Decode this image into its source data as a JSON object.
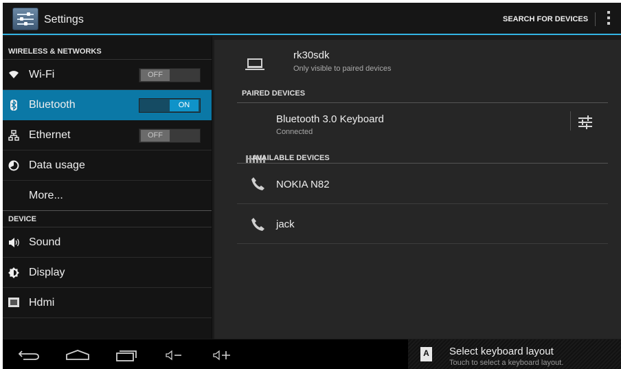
{
  "action_bar": {
    "title": "Settings",
    "search_label": "SEARCH FOR DEVICES",
    "app_icon": "settings-sliders-icon",
    "overflow_icon": "overflow-menu-icon"
  },
  "sidebar": {
    "wireless_header": "WIRELESS & NETWORKS",
    "device_header": "DEVICE",
    "items": [
      {
        "label": "Wi-Fi",
        "icon": "wifi-icon",
        "toggle": "OFF"
      },
      {
        "label": "Bluetooth",
        "icon": "bluetooth-icon",
        "toggle": "ON"
      },
      {
        "label": "Ethernet",
        "icon": "ethernet-icon",
        "toggle": "OFF"
      },
      {
        "label": "Data usage",
        "icon": "data-usage-icon"
      },
      {
        "label": "More..."
      },
      {
        "label": "Sound",
        "icon": "speaker-icon"
      },
      {
        "label": "Display",
        "icon": "brightness-icon"
      },
      {
        "label": "Hdmi",
        "icon": "hdmi-icon"
      }
    ],
    "selected": "Bluetooth"
  },
  "bluetooth": {
    "this_device": {
      "name": "rk30sdk",
      "status": "Only visible to paired devices",
      "icon": "laptop-icon"
    },
    "paired_header": "PAIRED DEVICES",
    "paired": [
      {
        "name": "Bluetooth 3.0 Keyboard",
        "status": "Connected",
        "icon": "keyboard-icon",
        "settings_icon": "tune-settings-icon"
      }
    ],
    "available_header": "AVAILABLE DEVICES",
    "available": [
      {
        "name": "NOKIA N82",
        "icon": "phone-icon"
      },
      {
        "name": "jack",
        "icon": "phone-icon"
      }
    ]
  },
  "system_bar": {
    "nav_icons": [
      "back-icon",
      "home-icon",
      "recent-apps-icon",
      "volume-down-icon",
      "volume-up-icon"
    ],
    "notification": {
      "icon_letter": "A",
      "title": "Select keyboard layout",
      "subtitle": "Touch to select a keyboard layout."
    }
  },
  "colors": {
    "accent": "#33b5e5",
    "selected_item": "#0b78a6",
    "toggle_on": "#0f93c9"
  }
}
